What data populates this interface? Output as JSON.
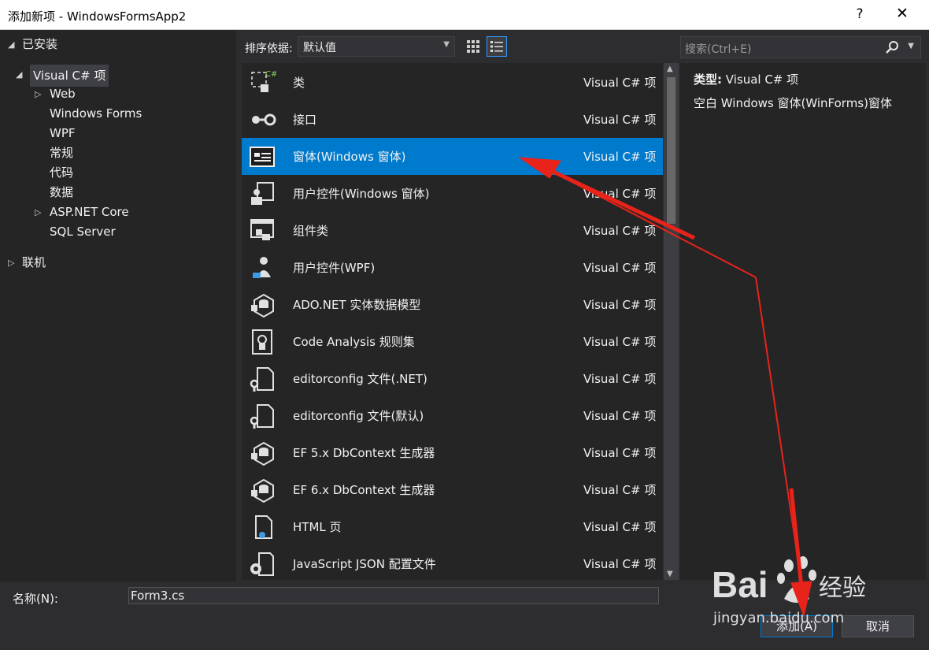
{
  "window": {
    "title": "添加新项 - WindowsFormsApp2",
    "help": "?",
    "close": "✕"
  },
  "tree": {
    "installed": "已安装",
    "items": [
      {
        "label": "Visual C# 项",
        "level": 1,
        "arrow": "◢",
        "selected": true
      },
      {
        "label": "Web",
        "level": 2,
        "arrow": "▷"
      },
      {
        "label": "Windows Forms",
        "level": 2
      },
      {
        "label": "WPF",
        "level": 2
      },
      {
        "label": "常规",
        "level": 2
      },
      {
        "label": "代码",
        "level": 2
      },
      {
        "label": "数据",
        "level": 2
      },
      {
        "label": "ASP.NET Core",
        "level": 2,
        "arrow": "▷"
      },
      {
        "label": "SQL Server",
        "level": 2
      }
    ],
    "online": "联机"
  },
  "toolbar": {
    "sort_label": "排序依据:",
    "sort_value": "默认值"
  },
  "search": {
    "placeholder": "搜索(Ctrl+E)"
  },
  "templates": [
    {
      "name": "类",
      "type": "Visual C# 项",
      "icon": "class-icon"
    },
    {
      "name": "接口",
      "type": "Visual C# 项",
      "icon": "interface-icon"
    },
    {
      "name": "窗体(Windows 窗体)",
      "type": "Visual C# 项",
      "icon": "form-icon",
      "selected": true
    },
    {
      "name": "用户控件(Windows 窗体)",
      "type": "Visual C# 项",
      "icon": "user-control-icon"
    },
    {
      "name": "组件类",
      "type": "Visual C# 项",
      "icon": "component-icon"
    },
    {
      "name": "用户控件(WPF)",
      "type": "Visual C# 项",
      "icon": "wpf-user-control-icon"
    },
    {
      "name": "ADO.NET 实体数据模型",
      "type": "Visual C# 项",
      "icon": "entity-model-icon"
    },
    {
      "name": "Code Analysis 规则集",
      "type": "Visual C# 项",
      "icon": "ruleset-icon"
    },
    {
      "name": "editorconfig 文件(.NET)",
      "type": "Visual C# 项",
      "icon": "config-file-icon"
    },
    {
      "name": "editorconfig 文件(默认)",
      "type": "Visual C# 项",
      "icon": "config-file-icon"
    },
    {
      "name": "EF 5.x DbContext 生成器",
      "type": "Visual C# 项",
      "icon": "entity-model-icon"
    },
    {
      "name": "EF 6.x DbContext 生成器",
      "type": "Visual C# 项",
      "icon": "entity-model-icon"
    },
    {
      "name": "HTML 页",
      "type": "Visual C# 项",
      "icon": "html-page-icon"
    },
    {
      "name": "JavaScript JSON 配置文件",
      "type": "Visual C# 项",
      "icon": "json-file-icon"
    }
  ],
  "details": {
    "type_label": "类型:",
    "type_value": "Visual C# 项",
    "description": "空白 Windows 窗体(WinForms)窗体"
  },
  "footer": {
    "name_label": "名称(N):",
    "name_value": "Form3.cs",
    "add_label": "添加(A)",
    "cancel_label": "取消"
  },
  "watermark": {
    "brand": "Bai",
    "brand_cn": "经验",
    "url": "jingyan.baidu.com"
  },
  "colors": {
    "selection": "#007acc",
    "annotation_arrow": "#e8231a"
  }
}
